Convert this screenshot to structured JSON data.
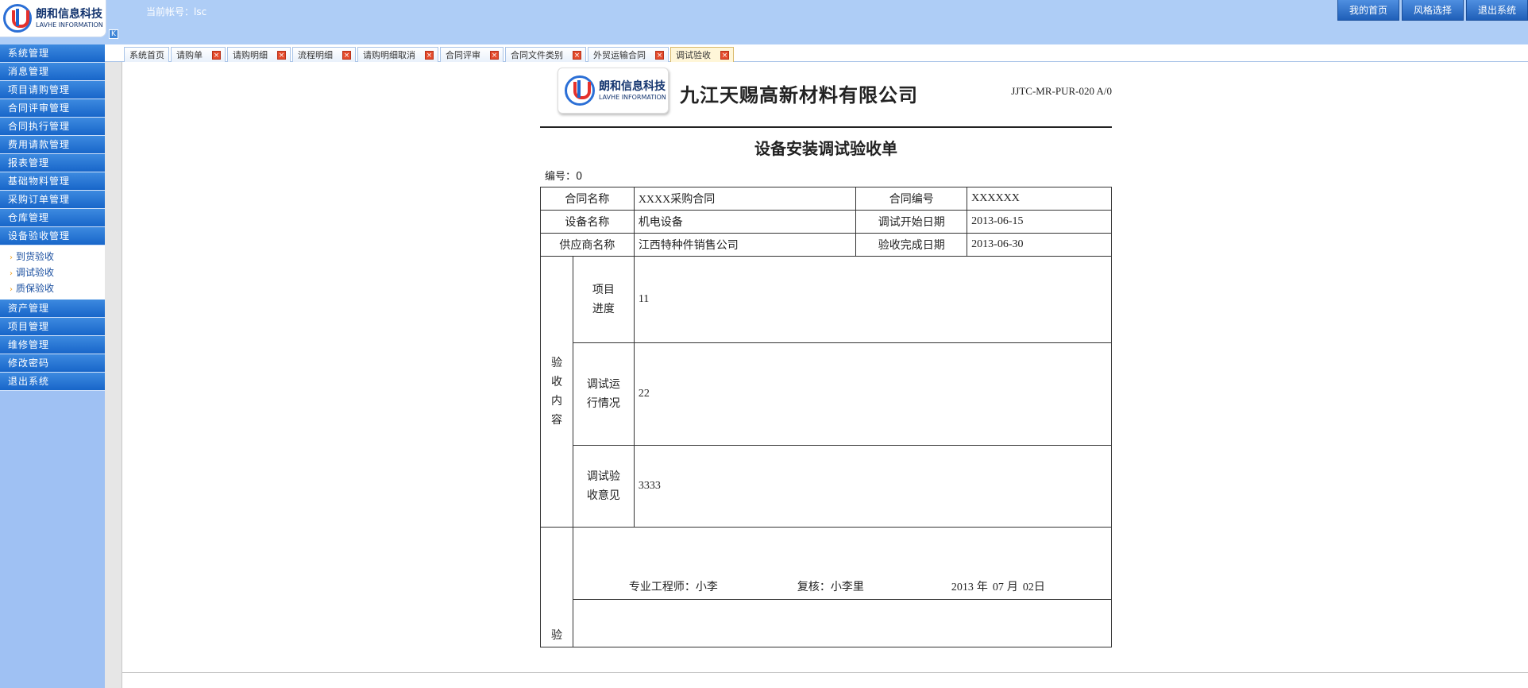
{
  "header": {
    "logo_cn": "朗和信息科技",
    "logo_en": "LAVHE INFORMATION",
    "account_label": "当前帐号：",
    "account_value": "lsc",
    "buttons": [
      "我的首页",
      "风格选择",
      "退出系统"
    ],
    "collapse_glyph": "K"
  },
  "sidebar": {
    "items_top": [
      "系统管理",
      "消息管理",
      "项目请购管理",
      "合同评审管理",
      "合同执行管理",
      "费用请款管理",
      "报表管理",
      "基础物料管理",
      "采购订单管理",
      "仓库管理",
      "设备验收管理"
    ],
    "sub_items": [
      "到货验收",
      "调试验收",
      "质保验收"
    ],
    "sub_arrow": "›",
    "items_bottom": [
      "资产管理",
      "项目管理",
      "维修管理",
      "修改密码",
      "退出系统"
    ]
  },
  "tabs": [
    {
      "label": "系统首页",
      "closable": false
    },
    {
      "label": "请购单",
      "closable": true
    },
    {
      "label": "请购明细",
      "closable": true
    },
    {
      "label": "流程明细",
      "closable": true
    },
    {
      "label": "请购明细取消",
      "closable": true
    },
    {
      "label": "合同评审",
      "closable": true
    },
    {
      "label": "合同文件类别",
      "closable": true
    },
    {
      "label": "外贸运输合同",
      "closable": true
    },
    {
      "label": "调试验收",
      "closable": true,
      "active": true
    }
  ],
  "tab_close_glyph": "×",
  "doc": {
    "company": "九江天赐高新材料有限公司",
    "code": "JJTC-MR-PUR-020 A/0",
    "title": "设备安装调试验收单",
    "number_label": "编号：",
    "number_value": "0",
    "row1": {
      "l1": "合同名称",
      "v1": "XXXX采购合同",
      "l2": "合同编号",
      "v2": "XXXXXX"
    },
    "row2": {
      "l1": "设备名称",
      "v1": "机电设备",
      "l2": "调试开始日期",
      "v2": "2013-06-15"
    },
    "row3": {
      "l1": "供应商名称",
      "v1": "江西特种件销售公司",
      "l2": "验收完成日期",
      "v2": "2013-06-30"
    },
    "section_label": [
      "验",
      "收",
      "内",
      "容"
    ],
    "sub1": {
      "label": [
        "项目",
        "进度"
      ],
      "value": "11"
    },
    "sub2": {
      "label": [
        "调试运",
        "行情况"
      ],
      "value": "22"
    },
    "sub3": {
      "label": [
        "调试验",
        "收意见"
      ],
      "value": "3333"
    },
    "sign": {
      "engineer_label": "专业工程师：",
      "engineer": "小李",
      "review_label": "复核：",
      "reviewer": "小李里",
      "year": "2013",
      "year_unit": "年",
      "month": "07",
      "month_unit": "月",
      "day": "02",
      "day_unit": "日"
    },
    "bottom_label": "验"
  },
  "colors": {
    "header_bg": "#aecdf6",
    "sidebar_bg": "#9fc1f3",
    "nav_blue": "#1866c9",
    "tab_close": "#e44b2c"
  }
}
